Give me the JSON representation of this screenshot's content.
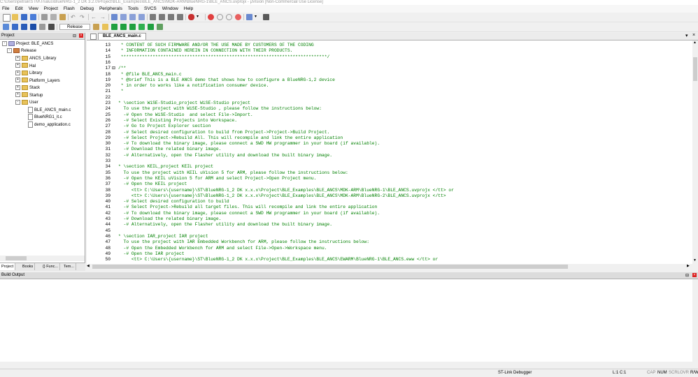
{
  "window": {
    "title": "C:\\Users\\petrak\\STM\\Trialus\\BlueNRG-1_2 DK 3.2.0\\Project\\BLE_Examples\\BLE_ANCS\\MDK-ARM\\BlueNRG-1\\BLE_ANCS.uvprojx - µVision [Non-Commercial Use License]"
  },
  "menu": [
    "File",
    "Edit",
    "View",
    "Project",
    "Flash",
    "Debug",
    "Peripherals",
    "Tools",
    "SVCS",
    "Window",
    "Help"
  ],
  "toolbar": {
    "target_select": "Release"
  },
  "project_panel": {
    "title": "Project",
    "root": "Project: BLE_ANCS",
    "target": "Release",
    "groups": [
      {
        "label": "ANCS_Library"
      },
      {
        "label": "Hal"
      },
      {
        "label": "Library"
      },
      {
        "label": "Platform_Layers"
      },
      {
        "label": "Stack"
      },
      {
        "label": "Startup"
      },
      {
        "label": "User"
      }
    ],
    "user_files": [
      "BLE_ANCS_main.c",
      "BlueNRG1_it.c",
      "demo_application.c"
    ],
    "tabs": [
      "Project",
      "Books",
      "{} Func...",
      "Tem..."
    ]
  },
  "editor": {
    "tab": "BLE_ANCS_main.c",
    "lines": [
      {
        "n": "13",
        "f": "",
        "t": " * CONTENT OF SUCH FIRMWARE AND/OR THE USE MADE BY CUSTOMERS OF THE CODING"
      },
      {
        "n": "14",
        "f": "",
        "t": " * INFORMATION CONTAINED HEREIN IN CONNECTION WITH THEIR PRODUCTS."
      },
      {
        "n": "15",
        "f": "",
        "t": " ******************************************************************************/"
      },
      {
        "n": "16",
        "f": "",
        "t": ""
      },
      {
        "n": "17",
        "f": "⊟",
        "t": "/**"
      },
      {
        "n": "18",
        "f": "",
        "t": " * @file BLE_ANCS_main.c"
      },
      {
        "n": "19",
        "f": "",
        "t": " * @brief This is a BLE ANCS demo that shows how to configure a BlueNRG-1,2 device"
      },
      {
        "n": "20",
        "f": "",
        "t": " * in order to works like a notification consumer device."
      },
      {
        "n": "21",
        "f": "",
        "t": " *"
      },
      {
        "n": "22",
        "f": "",
        "t": ""
      },
      {
        "n": "23",
        "f": "",
        "t": "* \\section WiSE-Studio_project WiSE-Studio project"
      },
      {
        "n": "24",
        "f": "",
        "t": "  To use the project with WiSE-Studio , please follow the instructions below:"
      },
      {
        "n": "25",
        "f": "",
        "t": "  -# Open the WiSE-Studio  and select File->Import."
      },
      {
        "n": "26",
        "f": "",
        "t": "  -# Select Existing Projects into Workspace."
      },
      {
        "n": "27",
        "f": "",
        "t": "  -# Go to Project Explorer section"
      },
      {
        "n": "28",
        "f": "",
        "t": "  -# Select desired configuration to build from Project->Project->Build Project."
      },
      {
        "n": "29",
        "f": "",
        "t": "  -# Select Project->Rebuild All. This will recompile and link the entire application"
      },
      {
        "n": "30",
        "f": "",
        "t": "  -# To download the binary image, please connect a SWD HW programmer in your board (if available)."
      },
      {
        "n": "31",
        "f": "",
        "t": "  -# Download the related binary image."
      },
      {
        "n": "32",
        "f": "",
        "t": "  -# Alternatively, open the Flasher utility and download the built binary image."
      },
      {
        "n": "33",
        "f": "",
        "t": ""
      },
      {
        "n": "34",
        "f": "",
        "t": "* \\section KEIL_project KEIL project"
      },
      {
        "n": "35",
        "f": "",
        "t": "  To use the project with KEIL uVision 5 for ARM, please follow the instructions below:"
      },
      {
        "n": "36",
        "f": "",
        "t": "  -# Open the KEIL uVision 5 for ARM and select Project->Open Project menu."
      },
      {
        "n": "37",
        "f": "",
        "t": "  -# Open the KEIL project"
      },
      {
        "n": "38",
        "f": "",
        "t": "     <tt> C:\\Users\\{username}\\ST\\BlueNRG-1_2 DK x.x.x\\Project\\BLE_Examples\\BLE_ANCS\\MDK-ARM\\BlueNRG-1\\BLE_ANCS.uvprojx </tt> or"
      },
      {
        "n": "39",
        "f": "",
        "t": "     <tt> C:\\Users\\{username}\\ST\\BlueNRG-1_2 DK x.x.x\\Project\\BLE_Examples\\BLE_ANCS\\MDK-ARM\\BlueNRG-2\\BLE_ANCS.uvprojx </tt>"
      },
      {
        "n": "40",
        "f": "",
        "t": "  -# Select desired configuration to build"
      },
      {
        "n": "41",
        "f": "",
        "t": "  -# Select Project->Rebuild all target files. This will recompile and link the entire application"
      },
      {
        "n": "42",
        "f": "",
        "t": "  -# To download the binary image, please connect a SWD HW programmer in your board (if available)."
      },
      {
        "n": "43",
        "f": "",
        "t": "  -# Download the related binary image."
      },
      {
        "n": "44",
        "f": "",
        "t": "  -# Alternatively, open the Flasher utility and download the built binary image."
      },
      {
        "n": "45",
        "f": "",
        "t": ""
      },
      {
        "n": "46",
        "f": "",
        "t": "* \\section IAR_project IAR project"
      },
      {
        "n": "47",
        "f": "",
        "t": "  To use the project with IAR Embedded Workbench for ARM, please follow the instructions below:"
      },
      {
        "n": "48",
        "f": "",
        "t": "  -# Open the Embedded Workbench for ARM and select File->Open->Workspace menu."
      },
      {
        "n": "49",
        "f": "",
        "t": "  -# Open the IAR project"
      },
      {
        "n": "50",
        "f": "",
        "t": "     <tt> C:\\Users\\{username}\\ST\\BlueNRG-1_2 DK x.x.x\\Project\\BLE_Examples\\BLE_ANCS\\EWARM\\BlueNRG-1\\BLE_ANCS.eww </tt> or"
      }
    ]
  },
  "build_output": {
    "title": "Build Output"
  },
  "statusbar": {
    "debugger": "ST-Link Debugger",
    "position": "L:1 C:1",
    "cap": "CAP",
    "num": "NUM",
    "scrl": "SCRL",
    "ovr": "OVR",
    "rw": "R/W"
  }
}
